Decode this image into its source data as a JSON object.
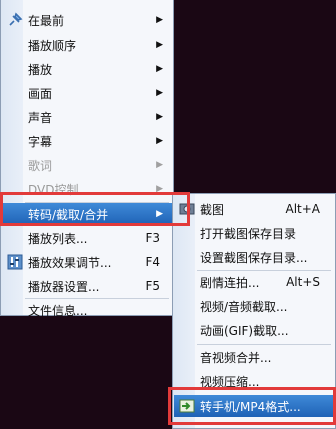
{
  "main_menu": {
    "items": [
      {
        "label": "在最前",
        "arrow": "▶"
      },
      {
        "label": "播放顺序",
        "arrow": "▶"
      },
      {
        "label": "播放",
        "arrow": "▶"
      },
      {
        "label": "画面",
        "arrow": "▶"
      },
      {
        "label": "声音",
        "arrow": "▶"
      },
      {
        "label": "字幕",
        "arrow": "▶"
      },
      {
        "label": "歌词",
        "arrow": "▶"
      },
      {
        "label": "DVD控制",
        "arrow": "▶"
      },
      {
        "label": "转码/截取/合并",
        "arrow": "▶"
      },
      {
        "label": "播放列表...",
        "shortcut": "F3"
      },
      {
        "label": "播放效果调节...",
        "shortcut": "F4"
      },
      {
        "label": "播放器设置...",
        "shortcut": "F5"
      },
      {
        "label": "文件信息..."
      }
    ]
  },
  "sub_menu": {
    "items": [
      {
        "label": "截图",
        "shortcut": "Alt+A"
      },
      {
        "label": "打开截图保存目录"
      },
      {
        "label": "设置截图保存目录..."
      },
      {
        "label": "剧情连拍...",
        "shortcut": "Alt+S"
      },
      {
        "label": "视频/音频截取..."
      },
      {
        "label": "动画(GIF)截取..."
      },
      {
        "label": "音视频合并..."
      },
      {
        "label": "视频压缩..."
      },
      {
        "label": "转手机/MP4格式..."
      }
    ]
  },
  "colors": {
    "highlight": "#2a6fc4",
    "annotation_red": "#e23a3a",
    "background": "#1a0714"
  }
}
